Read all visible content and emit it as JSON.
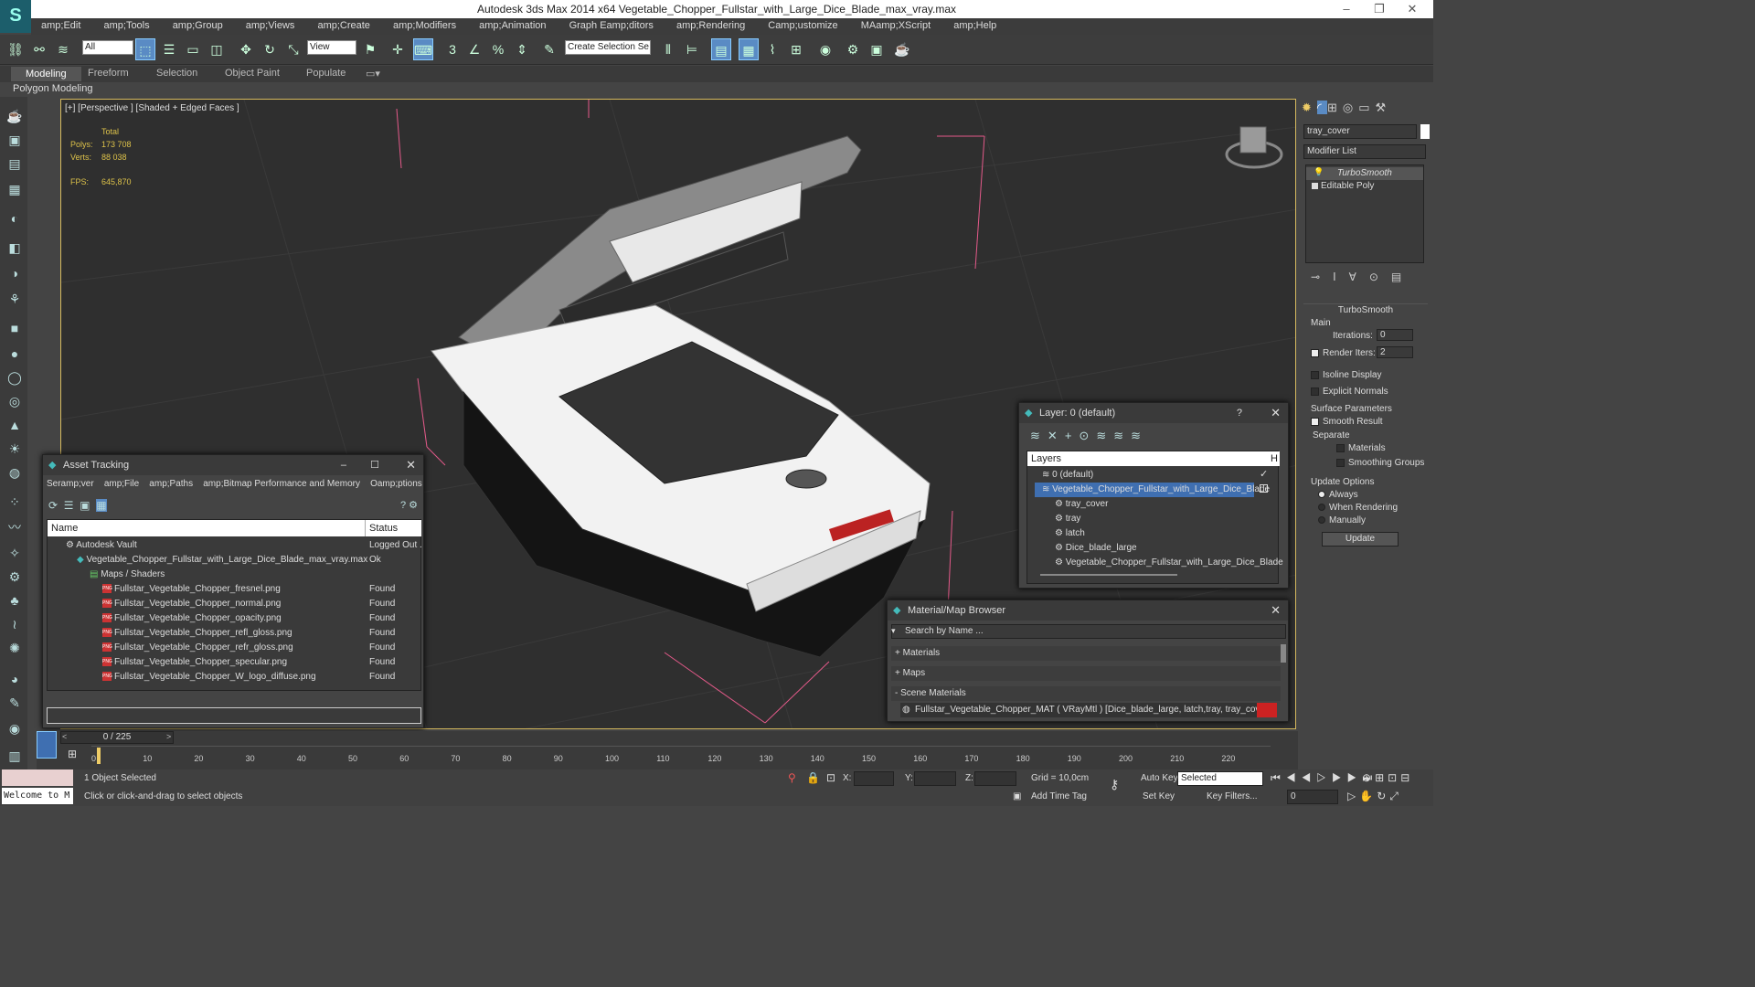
{
  "app": {
    "title": "Autodesk 3ds Max  2014 x64     Vegetable_Chopper_Fullstar_with_Large_Dice_Blade_max_vray.max"
  },
  "menu": [
    "amp;Edit",
    "amp;Tools",
    "amp;Group",
    "amp;Views",
    "amp;Create",
    "amp;Modifiers",
    "amp;Animation",
    "Graph Eamp;ditors",
    "amp;Rendering",
    "Camp;ustomize",
    "MAamp;XScript",
    "amp;Help"
  ],
  "toolbar": {
    "filter_value": "All",
    "refcoord_value": "View",
    "selection_set_placeholder": "Create Selection Se"
  },
  "ribbon": {
    "tabs": [
      "Modeling",
      "Freeform",
      "Selection",
      "Object Paint",
      "Populate"
    ],
    "active": "Modeling",
    "sub_label": "Polygon Modeling"
  },
  "viewport": {
    "label": "[+] [Perspective ] [Shaded + Edged Faces ]",
    "stats": {
      "total_label": "Total",
      "polys_label": "Polys:",
      "polys_value": "173 708",
      "verts_label": "Verts:",
      "verts_value": "88 038",
      "fps_label": "FPS:",
      "fps_value": "645,870"
    }
  },
  "command_panel": {
    "object_name": "tray_cover",
    "modifier_list_label": "Modifier List",
    "stack": [
      "TurboSmooth",
      "Editable Poly"
    ],
    "rollout_title": "TurboSmooth",
    "main_label": "Main",
    "iterations_label": "Iterations:",
    "iterations_value": "0",
    "render_iters_label": "Render Iters:",
    "render_iters_value": "2",
    "isoline_label": "Isoline Display",
    "explicit_normals_label": "Explicit Normals",
    "surface_params_label": "Surface Parameters",
    "smooth_result_label": "Smooth Result",
    "separate_label": "Separate",
    "materials_label": "Materials",
    "smoothing_groups_label": "Smoothing Groups",
    "update_options_label": "Update Options",
    "always_label": "Always",
    "when_rendering_label": "When Rendering",
    "manually_label": "Manually",
    "update_button": "Update"
  },
  "asset_tracking": {
    "title": "Asset Tracking",
    "menu": [
      "Seramp;ver",
      "amp;File",
      "amp;Paths",
      "amp;Bitmap Performance and Memory",
      "Oamp;ptions"
    ],
    "col_name": "Name",
    "col_status": "Status",
    "rows": [
      {
        "name": "Autodesk Vault",
        "status": "Logged Out ."
      },
      {
        "name": "Vegetable_Chopper_Fullstar_with_Large_Dice_Blade_max_vray.max",
        "status": "Ok"
      },
      {
        "name": "Maps / Shaders",
        "status": ""
      },
      {
        "name": "Fullstar_Vegetable_Chopper_fresnel.png",
        "status": "Found"
      },
      {
        "name": "Fullstar_Vegetable_Chopper_normal.png",
        "status": "Found"
      },
      {
        "name": "Fullstar_Vegetable_Chopper_opacity.png",
        "status": "Found"
      },
      {
        "name": "Fullstar_Vegetable_Chopper_refl_gloss.png",
        "status": "Found"
      },
      {
        "name": "Fullstar_Vegetable_Chopper_refr_gloss.png",
        "status": "Found"
      },
      {
        "name": "Fullstar_Vegetable_Chopper_specular.png",
        "status": "Found"
      },
      {
        "name": "Fullstar_Vegetable_Chopper_W_logo_diffuse.png",
        "status": "Found"
      }
    ]
  },
  "layers": {
    "title": "Layer: 0 (default)",
    "help": "?",
    "col_layers": "Layers",
    "col_h": "H",
    "items": [
      "0 (default)",
      "Vegetable_Chopper_Fullstar_with_Large_Dice_Blade",
      "tray_cover",
      "tray",
      "latch",
      "Dice_blade_large",
      "Vegetable_Chopper_Fullstar_with_Large_Dice_Blade"
    ]
  },
  "material_browser": {
    "title": "Material/Map Browser",
    "search_placeholder": "Search by Name ...",
    "sections": [
      "+ Materials",
      "+ Maps",
      "- Scene Materials"
    ],
    "scene_material": "Fullstar_Vegetable_Chopper_MAT ( VRayMtl ) [Dice_blade_large, latch,tray, tray_cover]"
  },
  "timeline": {
    "frame_label": "0 / 225",
    "ticks": [
      "0",
      "10",
      "20",
      "30",
      "40",
      "50",
      "60",
      "70",
      "80",
      "90",
      "100",
      "110",
      "120",
      "130",
      "140",
      "150",
      "160",
      "170",
      "180",
      "190",
      "200",
      "210",
      "220"
    ]
  },
  "status": {
    "maxscript_text": "Welcome to M",
    "selected_text": "1 Object Selected",
    "prompt_text": "Click or click-and-drag to select objects",
    "x_label": "X:",
    "y_label": "Y:",
    "z_label": "Z:",
    "grid_text": "Grid = 10,0cm",
    "add_time_tag": "Add Time Tag",
    "auto_key": "Auto Key",
    "set_key": "Set Key",
    "selected_dropdown": "Selected",
    "key_filters": "Key Filters...",
    "frame_value": "0"
  },
  "colors": {
    "accent": "#5a8bc4",
    "viewport_border": "#d6b95e",
    "stats": "#ddc24a"
  }
}
